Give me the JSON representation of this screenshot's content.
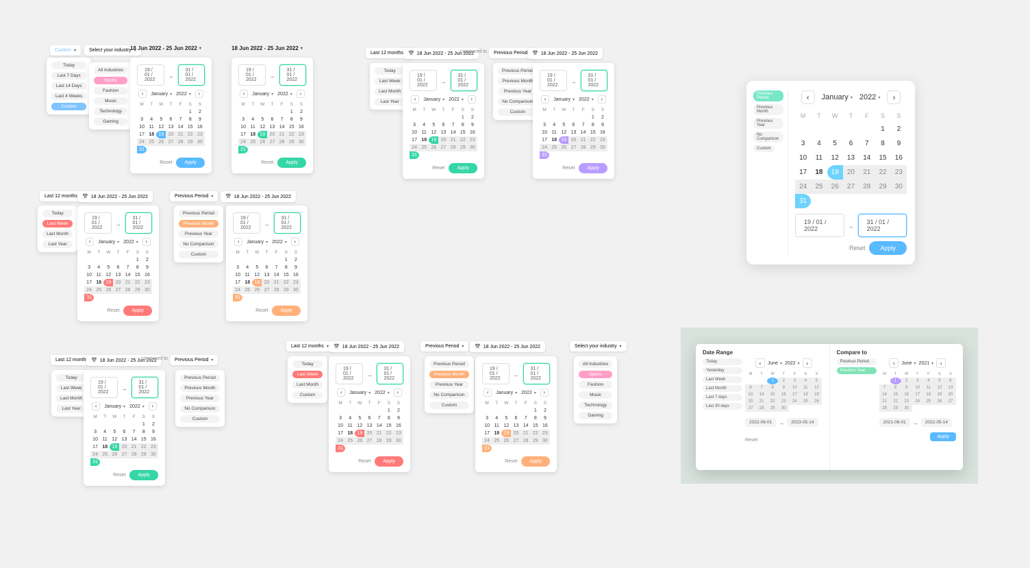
{
  "dates": {
    "start": "19 / 01 / 2022",
    "end": "31 / 01 / 2022",
    "range_label": "18 Jun 2022 - 25 Jun 2022"
  },
  "month": {
    "name": "January",
    "year": "2022"
  },
  "dow": [
    "M",
    "T",
    "W",
    "T",
    "F",
    "S",
    "S"
  ],
  "actions": {
    "reset": "Reset",
    "apply": "Apply"
  },
  "cmp_label": "compared to",
  "triggers": {
    "industry": "Select your industry",
    "last12": "Last 12 months",
    "prev": "Previous Period"
  },
  "presets": {
    "custom_top": {
      "trigger": "Custom",
      "items": [
        "Today",
        "Last 7 Days",
        "Last 14 Days",
        "Last 4 Weeks",
        "Custom"
      ],
      "selIdx": 4,
      "color": "#7fc3ff"
    },
    "industries": {
      "items": [
        "All Industries",
        "Sports",
        "Fashion",
        "Music",
        "Technology",
        "Gaming"
      ],
      "selIdx": 1,
      "color": "#ff9fc8"
    },
    "last12": {
      "items": [
        "Today",
        "Last Week",
        "Last Month",
        "Last Year"
      ],
      "selIdx": -1
    },
    "row2_left": {
      "items": [
        "Today",
        "Last Week",
        "Last Month",
        "Last Year"
      ],
      "selIdx": 1,
      "color": "#ff7a78"
    },
    "prev_comp": {
      "items": [
        "Previous Period",
        "Previous Month",
        "Previous Year",
        "No Comparison",
        "Custom"
      ],
      "selIdx": 1,
      "color": "#ffb07a"
    },
    "row3_left": {
      "items": [
        "Today",
        "Last Week",
        "Last Month",
        "Last Year"
      ],
      "selIdx": -1
    },
    "row3_comp": {
      "items": [
        "Previous Period",
        "Previous Month",
        "Previous Year",
        "No Comparison",
        "Custom"
      ],
      "selIdx": -1
    },
    "row3_b_left": {
      "items": [
        "Today",
        "Last Week",
        "Last Month",
        "Custom"
      ],
      "selIdx": 1,
      "color": "#ff7a78"
    },
    "row3_b_comp": {
      "items": [
        "Previous Period",
        "Previous Month",
        "Previous Year",
        "No Comparison",
        "Custom"
      ],
      "selIdx": 1,
      "color": "#ffb07a"
    },
    "row3_b_ind": {
      "items": [
        "All Industries",
        "Sports",
        "Fashion",
        "Music",
        "Technology",
        "Gaming"
      ],
      "selIdx": 1,
      "color": "#ff9fc8"
    },
    "big": {
      "items": [
        "Previous Period",
        "Previous Month",
        "Previous Year",
        "No Comparison",
        "Custom"
      ],
      "selIdx": 0,
      "color": "#78e7c5"
    }
  },
  "calendars": {
    "blue_start19": {
      "accent": "#5ab9ff",
      "start": 19,
      "end": 31
    },
    "green_start19": {
      "accent": "#35d6a7",
      "start": 19,
      "end": 31
    },
    "purple": {
      "accent": "#b89cff",
      "start": 19,
      "end": 31
    },
    "red": {
      "accent": "#ff7a78",
      "start": 19,
      "end": 31
    },
    "orange": {
      "accent": "#ffb07a",
      "start": 19,
      "end": 31
    },
    "greenB": {
      "accent": "#35d6a7",
      "start": 19,
      "end": 31
    },
    "big": {
      "accent": "#6dd3ff",
      "start": 19,
      "end": 31
    }
  },
  "dual": {
    "left": {
      "title": "Date Range",
      "presets": [
        "Today",
        "Yesterday",
        "Last Week",
        "Last Month",
        "Last 7 days",
        "Last 30 days"
      ],
      "selIdx": -1,
      "month": "June",
      "year": "2022",
      "start": 1,
      "end": 1,
      "accent": "#5ab9ff",
      "range_extend": true,
      "from": "2022-06-01",
      "to": "2023-05-14"
    },
    "right": {
      "title": "Compare to",
      "presets": [
        "Previous Period",
        "Previous Year"
      ],
      "selIdx": 1,
      "selColor": "#7fe3b5",
      "month": "June",
      "year": "2021",
      "start": 1,
      "end": 1,
      "accent": "#b89cff",
      "range_extend": true,
      "from": "2021-06-01",
      "to": "2022-05-14"
    },
    "reset": "Reset",
    "apply": "Apply"
  }
}
